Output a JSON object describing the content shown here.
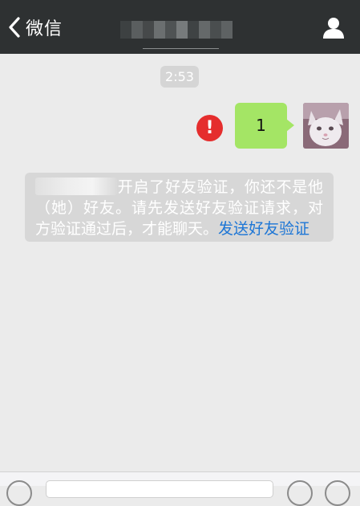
{
  "nav": {
    "back_label": "微信",
    "back_icon": "chevron-left-icon",
    "title_pixelated": true,
    "profile_icon": "person-icon",
    "background": "#2e3132"
  },
  "chat": {
    "timestamp": "2:53",
    "message": {
      "text": "1",
      "status_icon": "error-icon",
      "status_glyph": "!",
      "bubble_color": "#a4e565"
    },
    "system_notice": {
      "text_main": "开启了好友验证，你还不是他（她）好友。请先发送好友验证请求，对方验证通过后，才能聊天。",
      "link_text": "发送好友验证",
      "link_color": "#1d76d6"
    }
  },
  "input_bar": {
    "voice_icon": "voice-icon",
    "emoji_icon": "emoji-icon",
    "plus_icon": "plus-icon"
  }
}
